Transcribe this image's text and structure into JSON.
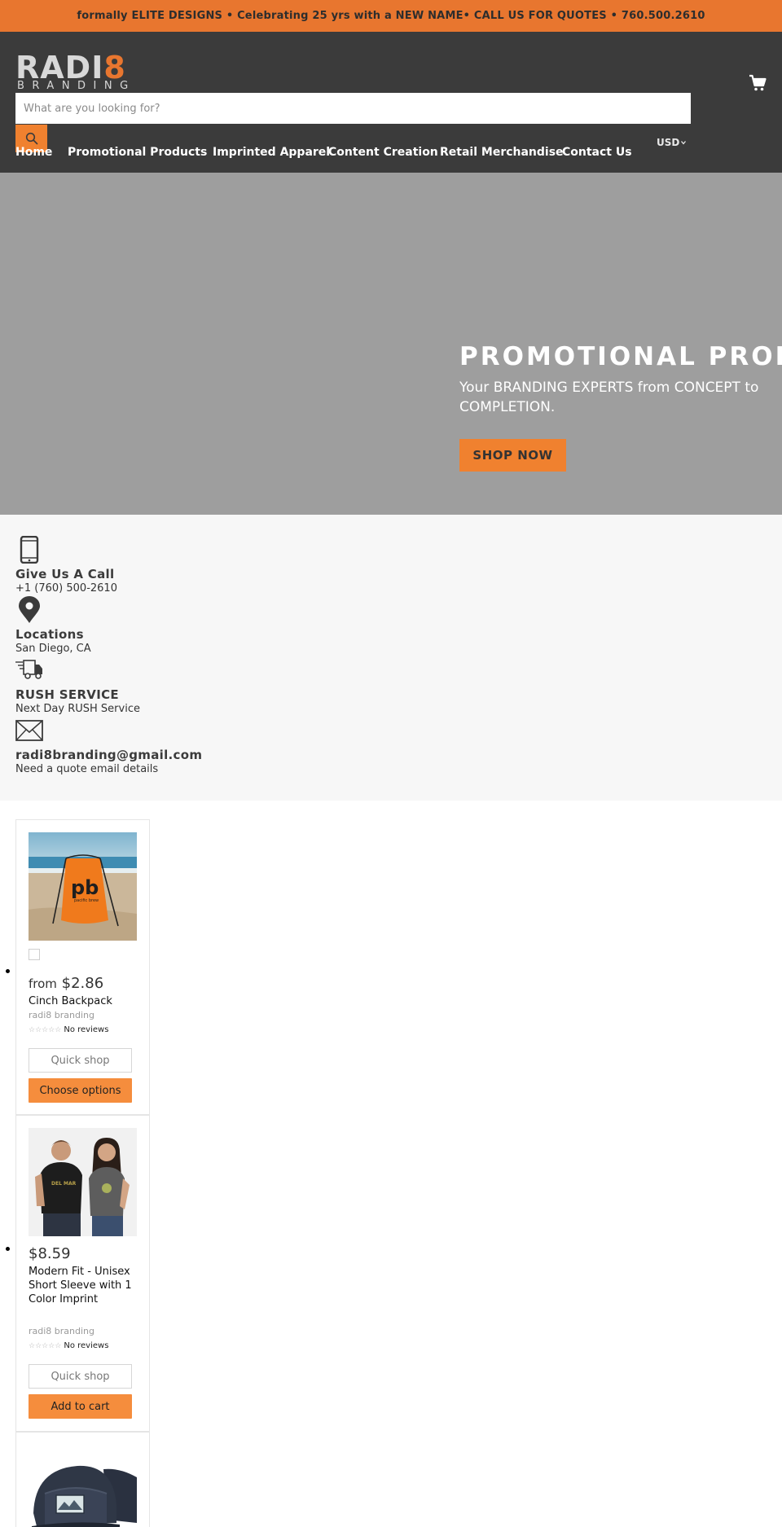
{
  "announcement": "formally ELITE DESIGNS • Celebrating 25 yrs with a NEW NAME•  CALL US FOR QUOTES • 760.500.2610",
  "brand": {
    "logo_main_grey": "RADI",
    "logo_main_orange": "8",
    "logo_sub": "BRANDING",
    "accent": "#e8762f",
    "header_bg": "#3b3b3b"
  },
  "search": {
    "placeholder": "What are you looking for?",
    "icon": "search-icon"
  },
  "cart_icon": "cart-icon",
  "nav": {
    "items": [
      "Home",
      "Promotional Products",
      "Imprinted Apparel",
      "Content Creation",
      "Retail Merchandise",
      "Contact Us"
    ],
    "currency": "USD"
  },
  "hero": {
    "title": "PROMOTIONAL PRODUCTS",
    "subtitle": "Your BRANDING EXPERTS from CONCEPT to COMPLETION.",
    "cta": "SHOP NOW",
    "bg": "#9e9e9e"
  },
  "info": [
    {
      "icon": "phone-icon",
      "title": "Give Us A Call",
      "text": "+1 (760) 500-2610"
    },
    {
      "icon": "map-pin-icon",
      "title": "Locations",
      "text": "San Diego, CA"
    },
    {
      "icon": "delivery-truck-icon",
      "title": "RUSH SERVICE",
      "text": "Next Day RUSH Service"
    },
    {
      "icon": "envelope-icon",
      "title": "radi8branding@gmail.com",
      "text": "Need a quote email details"
    }
  ],
  "products": [
    {
      "image": "orange cinch backpack on beach",
      "price_prefix": "from",
      "price": "$2.86",
      "title": "Cinch Backpack",
      "vendor": "radi8 branding",
      "reviews": "No reviews",
      "rating": 0,
      "quick": "Quick shop",
      "cta": "Choose options"
    },
    {
      "image": "two models in printed t-shirts",
      "price_prefix": "",
      "price": "$8.59",
      "title": "Modern Fit - Unisex Short Sleeve with 1 Color Imprint",
      "vendor": "radi8 branding",
      "reviews": "No reviews",
      "rating": 0,
      "quick": "Quick shop",
      "cta": "Add to cart"
    },
    {
      "image": "navy trucker caps with patch",
      "price_prefix": "",
      "price": "",
      "title": "",
      "vendor": "",
      "reviews": "",
      "rating": 0,
      "quick": "",
      "cta": ""
    }
  ]
}
